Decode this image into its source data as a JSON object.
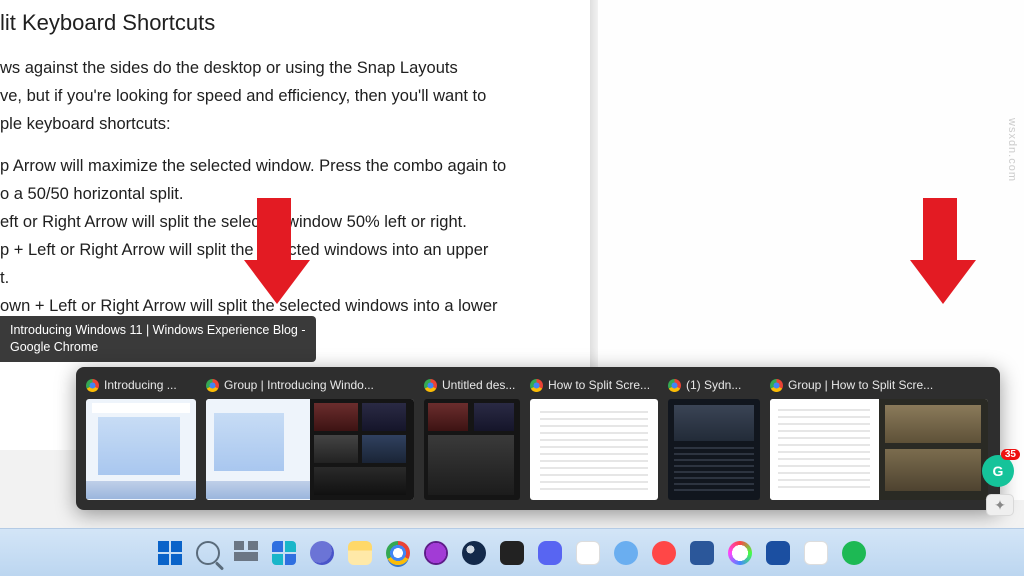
{
  "article": {
    "heading_fragment": "lit Keyboard Shortcuts",
    "para1_l1": "ws against the sides do the desktop or using the Snap Layouts",
    "para1_l2": "ve, but if you're looking for speed and efficiency, then you'll want to",
    "para1_l3": "ple keyboard shortcuts:",
    "li1_l1": "p Arrow will maximize the selected window. Press the combo again to",
    "li1_l2": "o a 50/50 horizontal split.",
    "li2": "eft or Right Arrow will split the selected window 50% left or right.",
    "li3_l1": "p + Left or Right Arrow will split the selected windows into an upper",
    "li3_l2": "t.",
    "li4": "own + Left or Right Arrow will split the selected windows into a lower"
  },
  "tooltip": {
    "line1": "Introducing Windows 11 | Windows Experience Blog -",
    "line2": "Google Chrome"
  },
  "taskview": {
    "items": [
      {
        "label": "Introducing ...",
        "preview": "win11",
        "w": "w-110"
      },
      {
        "label": "Group | Introducing Windo...",
        "preview": "group-win11",
        "w": "w-208"
      },
      {
        "label": "Untitled des...",
        "preview": "desk",
        "w": "w-96"
      },
      {
        "label": "How to Split Scre...",
        "preview": "doc",
        "w": "w-128"
      },
      {
        "label": "(1) Sydn...",
        "preview": "dark",
        "w": "w-92"
      },
      {
        "label": "Group | How to Split Scre...",
        "preview": "group-doc",
        "w": "w-218"
      }
    ]
  },
  "grammarly": {
    "letter": "G",
    "count": "35"
  },
  "taskbar": {
    "items": [
      {
        "name": "start",
        "cls": "winlogo"
      },
      {
        "name": "search",
        "cls": "search-ico"
      },
      {
        "name": "task-view",
        "cls": "taskview-ico"
      },
      {
        "name": "widgets",
        "cls": "widgets-ico"
      },
      {
        "name": "teams",
        "cls": "teams circle"
      },
      {
        "name": "file-explorer",
        "cls": "explorer rounded"
      },
      {
        "name": "chrome",
        "cls": "chrome active-underline"
      },
      {
        "name": "opera-gx",
        "cls": "opera"
      },
      {
        "name": "steam",
        "cls": "steam"
      },
      {
        "name": "epic-games",
        "cls": "epic rounded"
      },
      {
        "name": "discord",
        "cls": "discord"
      },
      {
        "name": "slack",
        "cls": "slack rounded"
      },
      {
        "name": "xbox-cloud",
        "cls": "xbox-cloud"
      },
      {
        "name": "ea",
        "cls": "ea"
      },
      {
        "name": "word",
        "cls": "word"
      },
      {
        "name": "paint",
        "cls": "paint"
      },
      {
        "name": "virtualbox",
        "cls": "vbox rounded"
      },
      {
        "name": "google-classroom",
        "cls": "gclass rounded"
      },
      {
        "name": "spotify",
        "cls": "spotify"
      }
    ]
  },
  "watermark": "wsxdn.com"
}
